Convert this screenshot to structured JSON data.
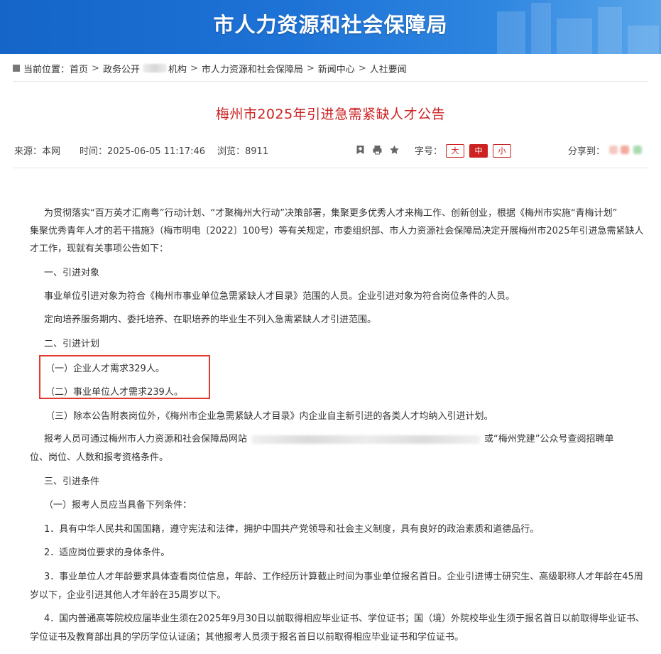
{
  "banner": {
    "title": "市人力资源和社会保障局"
  },
  "breadcrumb": {
    "prefix": "当前位置：",
    "items": [
      "首页",
      "政务公开",
      "机构",
      "市人力资源和社会保障局",
      "新闻中心",
      "人社要闻"
    ]
  },
  "article": {
    "title": "梅州市2025年引进急需紧缺人才公告",
    "source": "来源：本网",
    "time": "时间：2025-06-05 11:17:46",
    "views": "浏览：8911",
    "font_size_label": "字号：",
    "font_sizes": [
      "大",
      "中",
      "小"
    ],
    "share_label": "分享到："
  },
  "body": {
    "p1_line1": "为贯彻落实“百万英才汇南粤”行动计划、“才聚梅州大行动”决策部署，集聚更多优秀人才来梅工作、创新创业，根据《梅州市实施“青梅计划”",
    "p1_line2": "集聚优秀青年人才的若干措施》（梅市明电〔2022〕100号）等有关规定，市委组织部、市人力资源社会保障局决定开展梅州市2025年引进急需紧缺人",
    "p1_line3": "才工作，现就有关事项公告如下：",
    "h1": "一、引进对象",
    "p2": "事业单位引进对象为符合《梅州市事业单位急需紧缺人才目录》范围的人员。企业引进对象为符合岗位条件的人员。",
    "p3": "定向培养服务期内、委托培养、在职培养的毕业生不列入急需紧缺人才引进范围。",
    "h2": "二、引进计划",
    "plan1": "（一）企业人才需求329人。",
    "plan2": "（二）事业单位人才需求239人。",
    "plan3": "（三）除本公告附表岗位外，《梅州市企业急需紧缺人才目录》内企业自主新引进的各类人才均纳入引进计划。",
    "p4_line1_a": "报考人员可通过梅州市人力资源和社会保障局网站",
    "p4_line1_b": "或“梅州党建”公众号查阅招聘单",
    "p4_line2": "位、岗位、人数和报考资格条件。",
    "h3": "三、引进条件",
    "c0": "（一）报考人员应当具备下列条件：",
    "c1": "1．具有中华人民共和国国籍，遵守宪法和法律，拥护中国共产党领导和社会主义制度，具有良好的政治素质和道德品行。",
    "c2": "2．适应岗位要求的身体条件。",
    "c3_line1": "3．事业单位人才年龄要求具体查看岗位信息，年龄、工作经历计算截止时间为事业单位报名首日。企业引进博士研究生、高级职称人才年龄在45周",
    "c3_line2": "岁以下，企业引进其他人才年龄在35周岁以下。",
    "c4_line1": "4．国内普通高等院校应届毕业生须在2025年9月30日以前取得相应毕业证书、学位证书；国（境）外院校毕业生须于报名首日以前取得毕业证书、",
    "c4_line2": "学位证书及教育部出具的学历学位认证函；其他报考人员须于报名首日以前取得相应毕业证书和学位证书。"
  },
  "colors": {
    "accent": "#cc2222",
    "banner": "#1e73d6",
    "highlight": "#e23a2e"
  }
}
